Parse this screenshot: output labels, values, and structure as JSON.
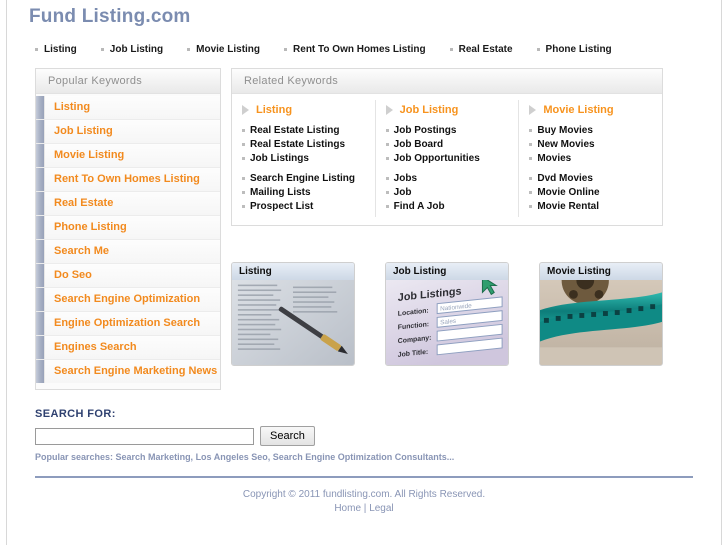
{
  "site": {
    "logo": "Fund Listing.com"
  },
  "topnav": {
    "items": [
      {
        "label": "Listing"
      },
      {
        "label": "Job Listing"
      },
      {
        "label": "Movie Listing"
      },
      {
        "label": "Rent To Own Homes Listing"
      },
      {
        "label": "Real Estate"
      },
      {
        "label": "Phone Listing"
      }
    ]
  },
  "sidebar": {
    "title": "Popular Keywords",
    "items": [
      {
        "label": "Listing"
      },
      {
        "label": "Job Listing"
      },
      {
        "label": "Movie Listing"
      },
      {
        "label": "Rent To Own Homes Listing"
      },
      {
        "label": "Real Estate"
      },
      {
        "label": "Phone Listing"
      },
      {
        "label": "Search Me"
      },
      {
        "label": "Do Seo"
      },
      {
        "label": "Search Engine Optimization"
      },
      {
        "label": "Engine Optimization Search"
      },
      {
        "label": "Engines Search"
      },
      {
        "label": "Search Engine Marketing News"
      }
    ]
  },
  "related": {
    "title": "Related Keywords",
    "columns": [
      {
        "heading": "Listing",
        "group_one": [
          "Real Estate Listing",
          "Real Estate Listings",
          "Job Listings"
        ],
        "group_two": [
          "Search Engine Listing",
          "Mailing Lists",
          "Prospect List"
        ]
      },
      {
        "heading": "Job Listing",
        "group_one": [
          "Job Postings",
          "Job Board",
          "Job Opportunities"
        ],
        "group_two": [
          "Jobs",
          "Job",
          "Find A Job"
        ]
      },
      {
        "heading": "Movie Listing",
        "group_one": [
          "Buy Movies",
          "New Movies",
          "Movies"
        ],
        "group_two": [
          "Dvd Movies",
          "Movie Online",
          "Movie Rental"
        ]
      }
    ]
  },
  "thumbnails": [
    {
      "caption": "Listing",
      "image": "newspaper-classifieds-with-pen-photo"
    },
    {
      "caption": "Job Listing",
      "image": "job-listings-web-form-screenshot"
    },
    {
      "caption": "Movie Listing",
      "image": "film-reel-teal-filmstrip-photo"
    }
  ],
  "search": {
    "label": "SEARCH FOR:",
    "value": "",
    "placeholder": "",
    "button": "Search",
    "popular": "Popular searches: Search Marketing, Los Angeles Seo, Search Engine Optimization Consultants..."
  },
  "footer": {
    "copyright": "Copyright © 2011 fundlisting.com. All Rights Reserved.",
    "home": "Home",
    "separator": "|",
    "legal": "Legal"
  },
  "colors": {
    "logo": "#7b8cb0",
    "keyword_orange": "#f28a1e",
    "heading_orange": "#f7931e",
    "footer_blue": "#8995b5",
    "rule_blue": "#8d9cbd"
  }
}
